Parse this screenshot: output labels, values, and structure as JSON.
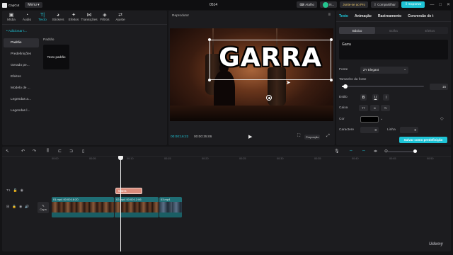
{
  "app": {
    "logo_text": "CapCut",
    "menu_label": "Menu",
    "project_name": "0514"
  },
  "titlebar": {
    "shortcuts_label": "Atalho",
    "user_label": "N...",
    "pro_label": "Junte-se ao Pro",
    "share_label": "Compartilhar",
    "export_label": "Exportar",
    "window_controls": [
      "—",
      "□",
      "✕"
    ]
  },
  "tool_tabs": [
    {
      "label": "Mídia",
      "icon": "▣"
    },
    {
      "label": "Áudio",
      "icon": "◔"
    },
    {
      "label": "Texto",
      "icon": "T|"
    },
    {
      "label": "Stickers",
      "icon": "◕"
    },
    {
      "label": "Efeitos",
      "icon": "✦"
    },
    {
      "label": "Transições",
      "icon": "⋈"
    },
    {
      "label": "Filtros",
      "icon": "◈"
    },
    {
      "label": "Ajuste",
      "icon": "⇄"
    }
  ],
  "text_sidebar": [
    "• Adicionar t...",
    "Padrão",
    "Predefinições",
    "Gerado pe...",
    "Efeitos",
    "Modelo de ...",
    "Legendas a...",
    "Legendas l..."
  ],
  "text_section_title": "Padrão",
  "preset_card_label": "Texto padrão",
  "player": {
    "label": "Reprodutor",
    "overlay_text": "GARRA",
    "current_time": "00:00:16:22",
    "total_time": "00:00:35:06",
    "ratio_label": "Proporção"
  },
  "right_panel": {
    "tabs": [
      "Texto",
      "Animação",
      "Rastreamento",
      "Conversão de t"
    ],
    "sub_tabs": [
      "Básico",
      "Bolha",
      "Efeitos"
    ],
    "text_value": "Garra",
    "font_label": "Fonte",
    "font_value": "ZY Elegant",
    "size_label": "Tamanho da fonte",
    "size_value": "15",
    "size_fraction": 0.04,
    "style_label": "Estilo",
    "style_buttons": [
      "B",
      "U",
      "I"
    ],
    "case_label": "Caixa",
    "case_buttons": [
      "TT",
      "tt",
      "Tt"
    ],
    "color_label": "Cor",
    "char_label": "Caractere",
    "char_value": "0",
    "line_label": "Linha",
    "line_value": "0",
    "save_preset_label": "Salvar como predefinição"
  },
  "timeline": {
    "ruler_ticks": [
      "00:00",
      "00:05",
      "00:10",
      "00:15",
      "00:20",
      "00:25",
      "00:30",
      "00:35",
      "00:40",
      "00:45",
      "00:50",
      "00:55"
    ],
    "text_clip_label": "Garra",
    "cover_label": "Capa",
    "clips": [
      {
        "label": "01.mp4  00:00:16:20"
      },
      {
        "label": "02.mp4  00:00:12:06"
      },
      {
        "label": "03.mp4"
      }
    ]
  },
  "watermark": "Udemy"
}
